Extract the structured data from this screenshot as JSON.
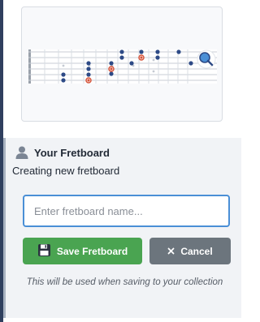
{
  "fretboard_preview": {
    "fret_count": 14,
    "string_count": 6,
    "note_color": "#2d4a86",
    "root_note_color": "#d6543a",
    "zoom_icon": "magnifier-icon"
  },
  "panel": {
    "icon": "user-icon",
    "title": "Your Fretboard",
    "subtitle": "Creating new fretboard",
    "name_input": {
      "value": "",
      "placeholder": "Enter fretboard name..."
    },
    "save_button": {
      "icon": "floppy-disk-icon",
      "label": "Save Fretboard",
      "color": "#4aa451"
    },
    "cancel_button": {
      "icon": "close-icon",
      "label": "Cancel",
      "color": "#6c757d"
    },
    "helper_text": "This will be used when saving to your collection"
  },
  "colors": {
    "accent": "#4a8fd6",
    "panel_background": "#f1f3f6"
  }
}
